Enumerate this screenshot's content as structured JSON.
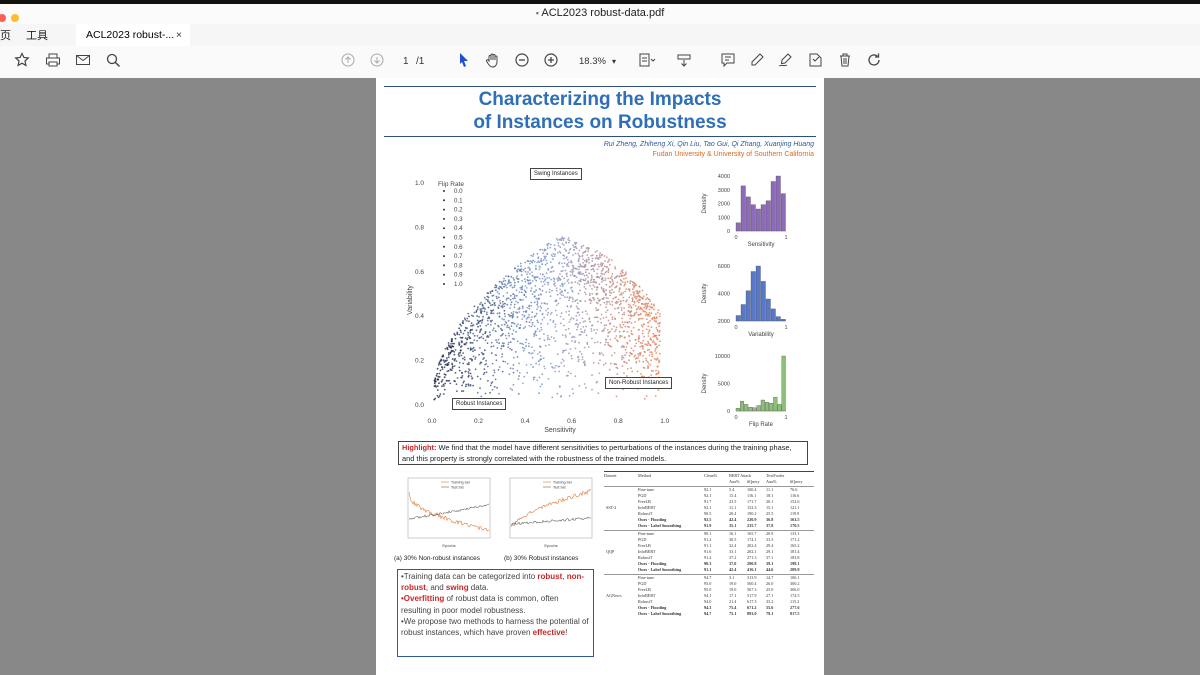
{
  "window": {
    "title": "ACL2023 robust-data.pdf",
    "traffic_lights": [
      "#ff5f57",
      "#febc2e",
      "#28c840"
    ]
  },
  "menu": {
    "home": "页",
    "tools": "工具"
  },
  "tab": {
    "label": "ACL2023 robust-...",
    "close": "×"
  },
  "toolbar": {
    "page_current": "1",
    "page_total": "/1",
    "zoom": "18.3%"
  },
  "poster": {
    "title_line1": "Characterizing the Impacts",
    "title_line2": "of Instances on Robustness",
    "authors": "Rui Zheng, Zhiheng Xi, Qin Liu, Tao Gui, Qi Zhang, Xuanjing Huang",
    "affiliation": "Fudan University & University of Southern California",
    "highlight_label": "Highlight:",
    "highlight_text": " We find that the model have different sensitivities to perturbations of the instances during the training phase, and this property is strongly correlated with the robustness of the trained models.",
    "callouts": {
      "swing": "Swing Instances",
      "nonrobust": "Non-Robust Instances",
      "robust": "Robust Instances"
    },
    "captions": {
      "a": "(a) 30% Non-robust instances",
      "b": "(b) 30% Robust instances"
    },
    "bullets": {
      "b1_pre": "•Training data can be categorized into ",
      "b1_robust": "robust",
      "b1_comma": ",",
      "b1_nonrobust": "non-robust",
      "b1_mid": ", and ",
      "b1_swing": "swing",
      "b1_post": " data.",
      "b2_over": "•Overfitting",
      "b2_post": " of robust data is common, often resulting in poor model robustness.",
      "b3_pre": "•We propose two methods to harness the potential of robust instances, which have proven ",
      "b3_eff": "effective",
      "b3_post": "!"
    },
    "table": {
      "headers": [
        "Dataset",
        "Method",
        "Clean%",
        "BERT Attack",
        "",
        "TextFooler",
        ""
      ],
      "subheaders": [
        "Aua%",
        "#Query",
        "Aua%",
        "#Query"
      ],
      "groups": [
        {
          "name": "SST-2",
          "rows": [
            [
              "Fine-tune",
              "92.1",
              "5.4",
              "100.4",
              "11.1",
              "76.6"
            ],
            [
              "PGD",
              "92.1",
              "15.4",
              "116.1",
              "18.1",
              "116.6"
            ],
            [
              "FreeLB",
              "91.7",
              "23.5",
              "171.7",
              "20.1",
              "152.6"
            ],
            [
              "InfoBERT",
              "92.1",
              "11.1",
              "152.3",
              "15.1",
              "121.1"
            ],
            [
              "RobustT",
              "90.5",
              "20.4",
              "190.2",
              "25.5",
              "119.9"
            ],
            [
              "Ours - Flooding",
              "92.5",
              "42.4",
              "220.9",
              "36.8",
              "163.5"
            ],
            [
              "Ours - Label Smoothing",
              "91.9",
              "35.1",
              "235.7",
              "37.8",
              "170.5"
            ]
          ]
        },
        {
          "name": "QQP",
          "rows": [
            [
              "Fine-tune",
              "90.1",
              "16.1",
              "165.7",
              "20.9",
              "133.1"
            ],
            [
              "PGD",
              "91.2",
              "30.5",
              "174.1",
              "33.3",
              "171.2"
            ],
            [
              "FreeLB",
              "91.1",
              "32.4",
              "202.4",
              "29.4",
              "165.2"
            ],
            [
              "InfoBERT",
              "91.6",
              "33.1",
              "202.1",
              "29.1",
              "181.4"
            ],
            [
              "RobustT",
              "91.2",
              "37.2",
              "271.3",
              "37.1",
              "183.8"
            ],
            [
              "Ours - Flooding",
              "90.3",
              "37.0",
              "290.8",
              "39.1",
              "198.1"
            ],
            [
              "Ours - Label Smoothing",
              "91.1",
              "42.4",
              "416.1",
              "44.6",
              "209.9"
            ]
          ]
        },
        {
          "name": "AGNews",
          "rows": [
            [
              "Fine-tune",
              "94.7",
              "3.1",
              "313.9",
              "14.7",
              "106.1"
            ],
            [
              "PGD",
              "95.0",
              "19.0",
              "560.4",
              "26.0",
              "300.2"
            ],
            [
              "FreeLB",
              "95.0",
              "19.0",
              "567.3",
              "25.0",
              "306.0"
            ],
            [
              "InfoBERT",
              "94.1",
              "17.1",
              "517.9",
              "27.1",
              "174.5"
            ],
            [
              "RobustT",
              "94.0",
              "21.4",
              "617.3",
              "33.2",
              "115.2"
            ],
            [
              "Ours - Flooding",
              "94.3",
              "75.4",
              "671.2",
              "55.6",
              "277.6"
            ],
            [
              "Ours - Label Smoothing",
              "94.7",
              "75.1",
              "893.0",
              "79.1",
              "917.5"
            ]
          ]
        }
      ]
    }
  },
  "chart_data": [
    {
      "type": "scatter",
      "xlabel": "Sensitivity",
      "ylabel": "Variability",
      "xlim": [
        0,
        1.1
      ],
      "ylim": [
        0,
        1.05
      ],
      "xticks": [
        "0.0",
        "0.2",
        "0.4",
        "0.6",
        "0.8",
        "1.0"
      ],
      "yticks": [
        "0.0",
        "0.2",
        "0.4",
        "0.6",
        "0.8",
        "1.0"
      ],
      "legend_title": "Flip Rate",
      "legend": [
        "0.0",
        "0.1",
        "0.2",
        "0.3",
        "0.4",
        "0.5",
        "0.6",
        "0.7",
        "0.8",
        "0.9",
        "1.0"
      ],
      "legend_position": "top-left",
      "colors": {
        "low": "#1f2a44",
        "mid": "#7f9fd8",
        "high": "#e7855c"
      }
    },
    {
      "type": "bar",
      "xlabel": "Sensitivity",
      "ylabel": "Density",
      "yticks": [
        "0",
        "1000",
        "2000",
        "3000",
        "4000"
      ],
      "xticks": [
        "0",
        "1"
      ],
      "color": "#8d6bb8",
      "values": [
        0.15,
        0.82,
        0.62,
        0.48,
        0.4,
        0.48,
        0.55,
        0.9,
        1.0,
        0.68
      ]
    },
    {
      "type": "bar",
      "xlabel": "Variability",
      "ylabel": "Density",
      "yticks": [
        "2000",
        "4000",
        "6000"
      ],
      "xticks": [
        "0",
        "1"
      ],
      "color": "#5a78c8",
      "values": [
        0.1,
        0.3,
        0.55,
        0.9,
        1.0,
        0.72,
        0.4,
        0.22,
        0.08,
        0.03
      ]
    },
    {
      "type": "bar",
      "xlabel": "Flip Rate",
      "ylabel": "Density",
      "yticks": [
        "0",
        "5000",
        "10000"
      ],
      "xticks": [
        "0",
        "1"
      ],
      "color": "#8dbf7b",
      "values": [
        0.05,
        0.18,
        0.12,
        0.07,
        0.06,
        0.1,
        0.2,
        0.16,
        0.14,
        0.25,
        0.12,
        1.0
      ]
    },
    {
      "type": "line",
      "xlabel": "Epochs",
      "series": [
        "Training Set",
        "Test Set"
      ],
      "colors": [
        "#e07a3a",
        "#666"
      ]
    },
    {
      "type": "line",
      "xlabel": "Epochs",
      "series": [
        "Training Set",
        "Test Set"
      ],
      "colors": [
        "#e07a3a",
        "#666"
      ]
    }
  ]
}
